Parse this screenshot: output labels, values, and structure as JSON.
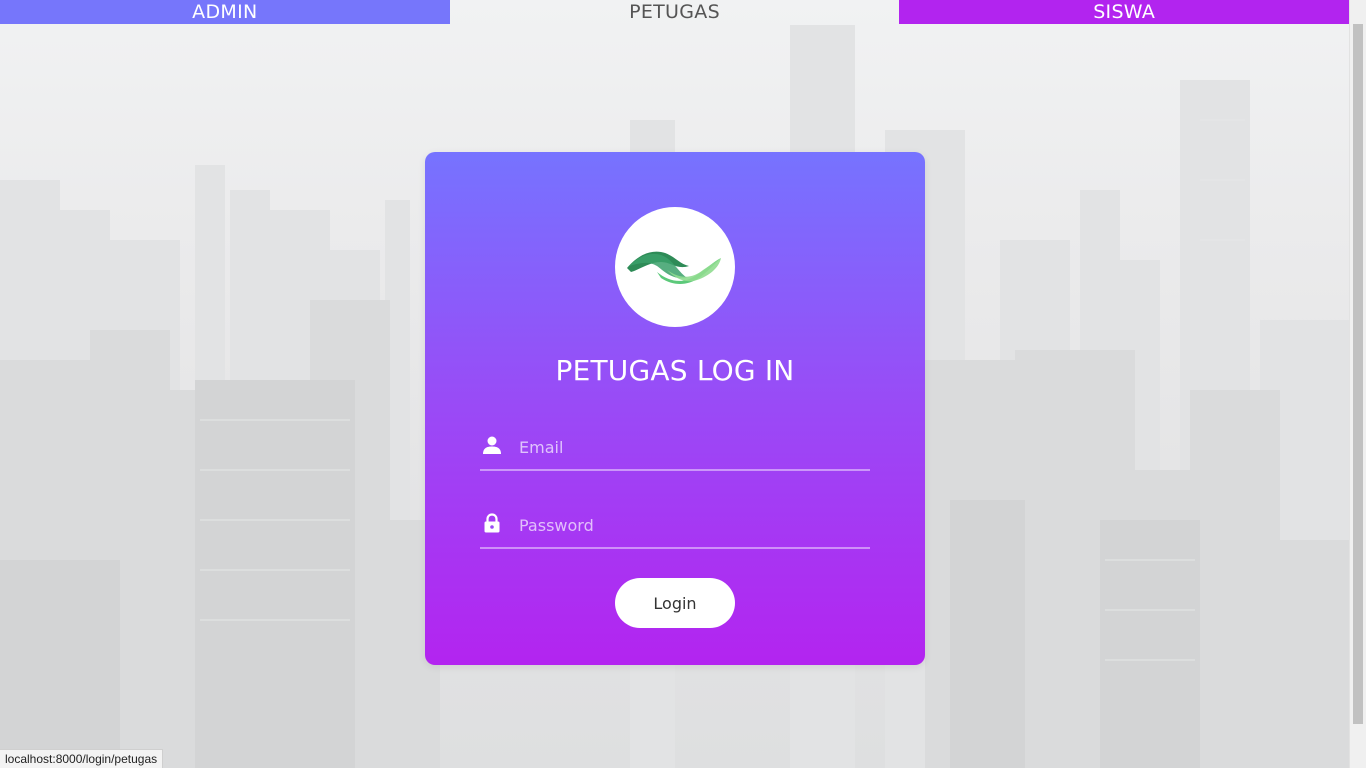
{
  "nav": {
    "tabs": [
      {
        "label": "ADMIN",
        "color": "#7676fb"
      },
      {
        "label": "PETUGAS",
        "active": true
      },
      {
        "label": "SISWA",
        "color": "#b224ef"
      }
    ]
  },
  "login": {
    "logo_icon": "wave-logo-icon",
    "title": "PETUGAS LOG IN",
    "email": {
      "placeholder": "Email",
      "value": "",
      "icon": "user-icon"
    },
    "password": {
      "placeholder": "Password",
      "value": "",
      "icon": "lock-icon"
    },
    "submit_label": "Login",
    "gradient_top": "#7673ff",
    "gradient_bottom": "#b324f0"
  },
  "status_bar": {
    "url": "localhost:8000/login/petugas"
  }
}
